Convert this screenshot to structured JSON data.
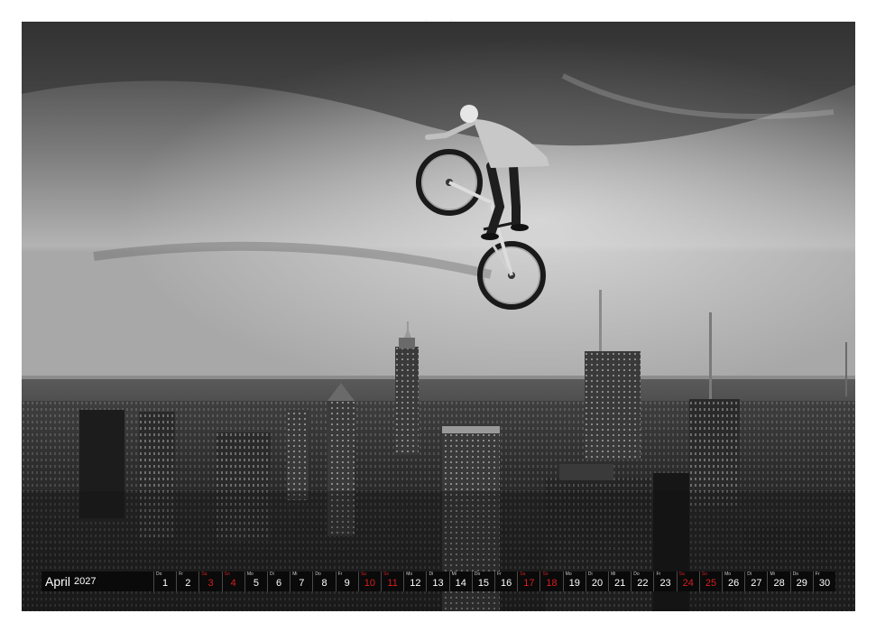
{
  "calendar": {
    "month": "April",
    "year": "2027",
    "days": [
      {
        "n": "1",
        "w": "Do",
        "red": false
      },
      {
        "n": "2",
        "w": "Fr",
        "red": false
      },
      {
        "n": "3",
        "w": "Sa",
        "red": true
      },
      {
        "n": "4",
        "w": "So",
        "red": true
      },
      {
        "n": "5",
        "w": "Mo",
        "red": false
      },
      {
        "n": "6",
        "w": "Di",
        "red": false
      },
      {
        "n": "7",
        "w": "Mi",
        "red": false
      },
      {
        "n": "8",
        "w": "Do",
        "red": false
      },
      {
        "n": "9",
        "w": "Fr",
        "red": false
      },
      {
        "n": "10",
        "w": "Sa",
        "red": true
      },
      {
        "n": "11",
        "w": "So",
        "red": true
      },
      {
        "n": "12",
        "w": "Mo",
        "red": false
      },
      {
        "n": "13",
        "w": "Di",
        "red": false
      },
      {
        "n": "14",
        "w": "Mi",
        "red": false
      },
      {
        "n": "15",
        "w": "Do",
        "red": false
      },
      {
        "n": "16",
        "w": "Fr",
        "red": false
      },
      {
        "n": "17",
        "w": "Sa",
        "red": true
      },
      {
        "n": "18",
        "w": "So",
        "red": true
      },
      {
        "n": "19",
        "w": "Mo",
        "red": false
      },
      {
        "n": "20",
        "w": "Di",
        "red": false
      },
      {
        "n": "21",
        "w": "Mi",
        "red": false
      },
      {
        "n": "22",
        "w": "Do",
        "red": false
      },
      {
        "n": "23",
        "w": "Fr",
        "red": false
      },
      {
        "n": "24",
        "w": "Sa",
        "red": true
      },
      {
        "n": "25",
        "w": "So",
        "red": true
      },
      {
        "n": "26",
        "w": "Mo",
        "red": false
      },
      {
        "n": "27",
        "w": "Di",
        "red": false
      },
      {
        "n": "28",
        "w": "Mi",
        "red": false
      },
      {
        "n": "29",
        "w": "Do",
        "red": false
      },
      {
        "n": "30",
        "w": "Fr",
        "red": false
      }
    ]
  },
  "colors": {
    "weekend": "#d81e1e",
    "strip": "#0a0a0a"
  },
  "photo": {
    "subject": "bmx-rider-jumping-over-city-skyline"
  }
}
